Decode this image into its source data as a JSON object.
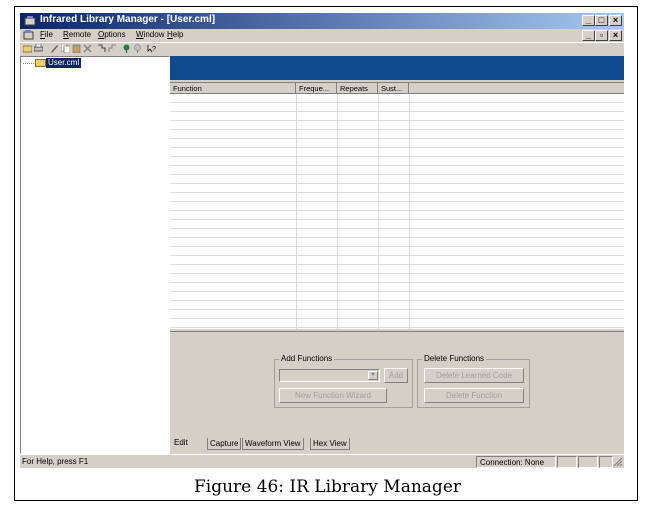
{
  "window": {
    "title": "Infrared Library Manager - [User.cml]",
    "controls": [
      "_",
      "□",
      "×"
    ],
    "mdi_controls": [
      "_",
      "▫",
      "×"
    ]
  },
  "menu": {
    "file": "File",
    "remote": "Remote",
    "options": "Options",
    "window": "Window",
    "help": "Help"
  },
  "toolbar": {
    "icons": [
      "open-icon",
      "print-icon",
      "edit-icon",
      "copy-icon",
      "paste-icon",
      "delete-icon",
      "capture-icon",
      "learn-icon",
      "send-icon",
      "receive-icon",
      "help-icon"
    ]
  },
  "tree": {
    "root": "User.cml"
  },
  "table": {
    "columns": [
      "Function",
      "Freque...",
      "Repeats",
      "Sust..."
    ]
  },
  "add_functions": {
    "legend": "Add Functions",
    "combo_value": "",
    "add_label": "Add",
    "wizard_label": "New Function Wizard"
  },
  "delete_functions": {
    "legend": "Delete Functions",
    "delete_learned_label": "Delete Learned Code",
    "delete_function_label": "Delete Function"
  },
  "tabs": [
    "Edit",
    "Capture",
    "Waveform View",
    "Hex View"
  ],
  "status": {
    "help_text": "For Help, press F1",
    "connection": "Connection: None"
  },
  "caption": "Figure 46: IR Library Manager",
  "colors": {
    "titlebar_start": "#0a246a",
    "titlebar_end": "#a6caf0",
    "header_banner": "#0f4a8a",
    "face": "#d4d0c8"
  }
}
